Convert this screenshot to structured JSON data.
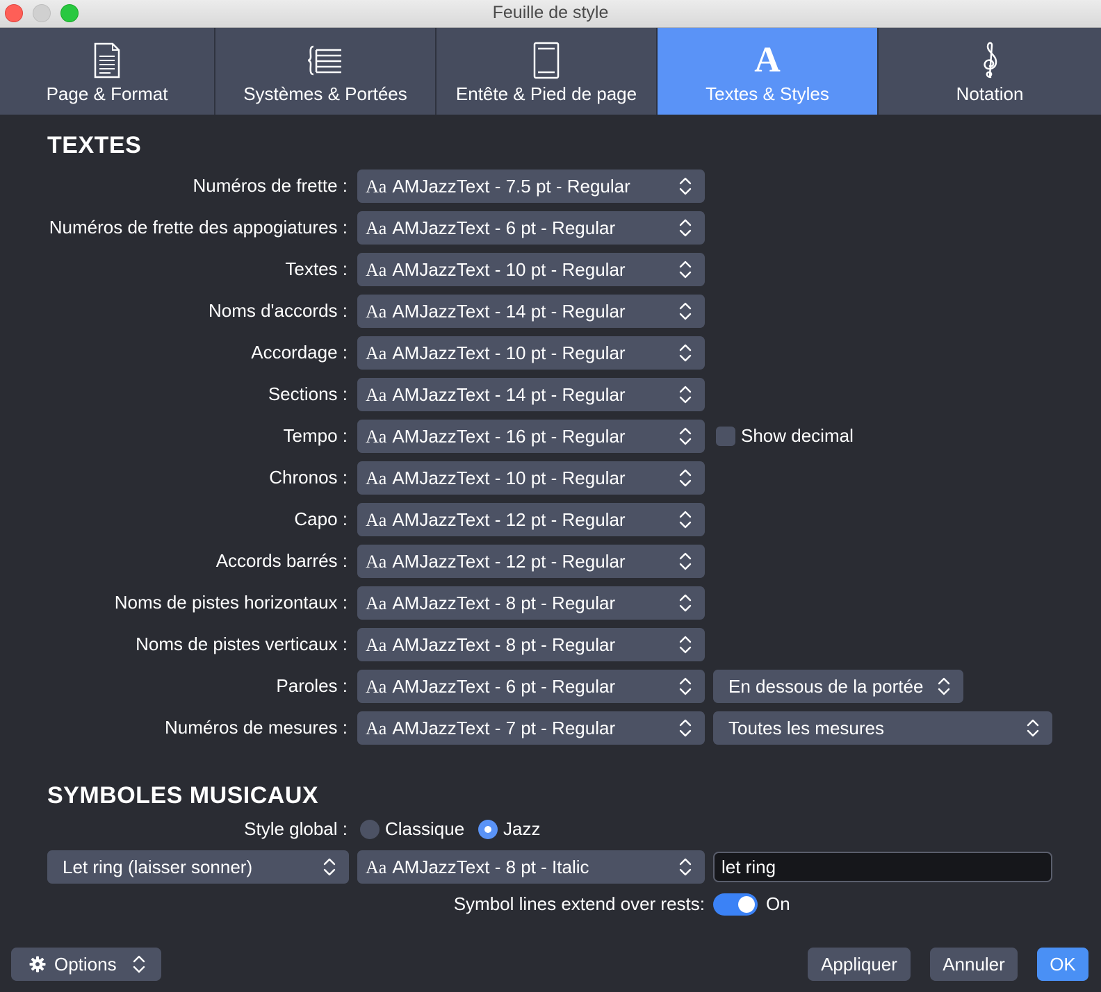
{
  "window": {
    "title": "Feuille de style"
  },
  "tabs": [
    {
      "label": "Page & Format",
      "icon": "page-icon",
      "active": false
    },
    {
      "label": "Systèmes & Portées",
      "icon": "staff-systems-icon",
      "active": false
    },
    {
      "label": "Entête & Pied de page",
      "icon": "header-footer-icon",
      "active": false
    },
    {
      "label": "Textes & Styles",
      "icon": "text-a-icon",
      "active": true
    },
    {
      "label": "Notation",
      "icon": "treble-clef-icon",
      "active": false
    }
  ],
  "texts_section": {
    "title": "TEXTES",
    "font_prefix": "Aa",
    "rows": [
      {
        "label": "Numéros de frette :",
        "value": "AMJazzText - 7.5 pt - Regular"
      },
      {
        "label": "Numéros de frette des appogiatures :",
        "value": "AMJazzText - 6 pt - Regular"
      },
      {
        "label": "Textes :",
        "value": "AMJazzText - 10 pt - Regular"
      },
      {
        "label": "Noms d'accords :",
        "value": "AMJazzText - 14 pt - Regular"
      },
      {
        "label": "Accordage :",
        "value": "AMJazzText - 10 pt - Regular"
      },
      {
        "label": "Sections :",
        "value": "AMJazzText - 14 pt - Regular"
      },
      {
        "label": "Tempo :",
        "value": "AMJazzText - 16 pt - Regular"
      },
      {
        "label": "Chronos :",
        "value": "AMJazzText - 10 pt - Regular"
      },
      {
        "label": "Capo :",
        "value": "AMJazzText - 12 pt - Regular"
      },
      {
        "label": "Accords barrés :",
        "value": "AMJazzText - 12 pt - Regular"
      },
      {
        "label": "Noms de pistes horizontaux :",
        "value": "AMJazzText - 8 pt - Regular"
      },
      {
        "label": "Noms de pistes verticaux :",
        "value": "AMJazzText - 8 pt - Regular"
      },
      {
        "label": "Paroles :",
        "value": "AMJazzText - 6 pt - Regular"
      },
      {
        "label": "Numéros de mesures :",
        "value": "AMJazzText - 7 pt - Regular"
      }
    ],
    "tempo_show_decimal": {
      "label": "Show decimal",
      "checked": false
    },
    "lyrics_position": "En dessous de la portée",
    "measure_numbers_option": "Toutes les mesures"
  },
  "symbols_section": {
    "title": "SYMBOLES MUSICAUX",
    "global_style_label": "Style global :",
    "style_options": [
      {
        "label": "Classique",
        "selected": false
      },
      {
        "label": "Jazz",
        "selected": true
      }
    ],
    "symbol_select": "Let ring (laisser sonner)",
    "symbol_font": "AMJazzText - 8 pt - Italic",
    "symbol_text": "let ring",
    "extend_label": "Symbol lines extend over rests:",
    "extend_toggle": {
      "on": true,
      "label": "On"
    }
  },
  "footer": {
    "options_label": "Options",
    "apply_label": "Appliquer",
    "cancel_label": "Annuler",
    "ok_label": "OK"
  },
  "colors": {
    "background": "#2a2c33",
    "tab_bg": "#464c5e",
    "tab_active": "#5a93f7",
    "control_bg": "#4c5264",
    "accent": "#4a90f5"
  }
}
